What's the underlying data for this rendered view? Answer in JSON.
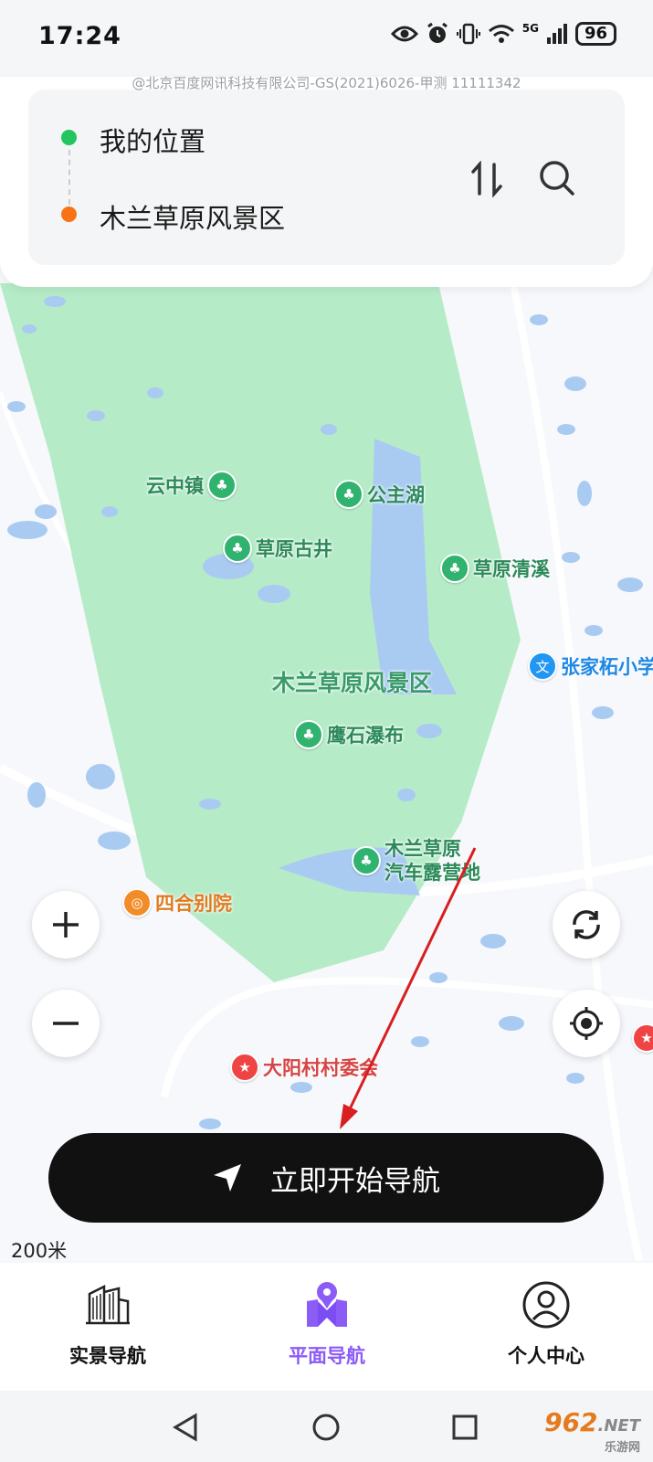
{
  "status_bar": {
    "time": "17:24",
    "network": "5G",
    "battery": "96"
  },
  "copyright": "@北京百度网讯科技有限公司-GS(2021)6026-甲测 11111342",
  "route": {
    "origin": "我的位置",
    "destination": "木兰草原风景区"
  },
  "colors": {
    "accent": "#8b5cf6",
    "park": "#b6ebc8",
    "water": "#a9cbf2",
    "start": "#22c55e",
    "end": "#f97316"
  },
  "map": {
    "area_label": "木兰草原风景区",
    "pois": {
      "yunzhongzhen": "云中镇",
      "gongzhuhu": "公主湖",
      "caoyuanguijing": "草原古井",
      "caoyuanqingxi": "草原清溪",
      "zhangjiaxi": "张家柘小学",
      "yingshipubu": "鹰石瀑布",
      "camp_line1": "木兰草原",
      "camp_line2": "汽车露营地",
      "siheyuan": "四合别院",
      "dayangcun": "大阳村村委会"
    },
    "scale": "200米"
  },
  "start_button": "立即开始导航",
  "tabs": [
    {
      "label": "实景导航",
      "icon": "building-icon"
    },
    {
      "label": "平面导航",
      "icon": "map-pin-icon"
    },
    {
      "label": "个人中心",
      "icon": "user-icon"
    }
  ],
  "watermark": {
    "brand": "962",
    "suffix": ".NET",
    "sub": "乐游网"
  }
}
